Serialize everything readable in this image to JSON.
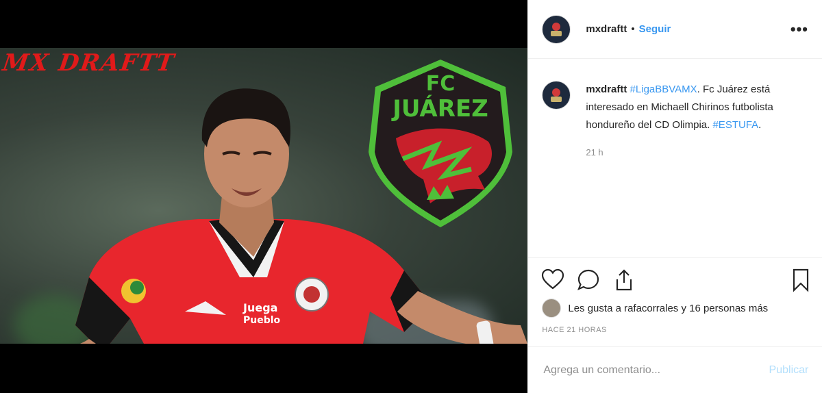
{
  "media": {
    "watermark": "MX DRAFTT",
    "crest": {
      "line1": "FC",
      "line2": "JUÁREZ"
    },
    "jersey_sponsor_line1": "Juega",
    "jersey_sponsor_line2": "Pueblo"
  },
  "header": {
    "username": "mxdraftt",
    "separator": "•",
    "follow_label": "Seguir",
    "more_label": "•••"
  },
  "caption": {
    "username": "mxdraftt",
    "hashtag1": "#LigaBBVAMX",
    "after_hashtag1": ".",
    "body": "Fc Juárez está interesado en Michaell Chirinos futbolista hondureño del CD Olimpia. ",
    "hashtag2": "#ESTUFA",
    "after_hashtag2": ".",
    "time": "21 h"
  },
  "likes": {
    "text": "Les gusta a rafacorrales y 16 personas más"
  },
  "timestamp": "HACE 21 HORAS",
  "comment_box": {
    "placeholder": "Agrega un comentario...",
    "publish_label": "Publicar"
  },
  "colors": {
    "link": "#3897f0",
    "publish_disabled": "#b2dffc",
    "jersey": "#e8262d",
    "crest_green": "#4fbf3a",
    "crest_dark": "#231b1d"
  }
}
